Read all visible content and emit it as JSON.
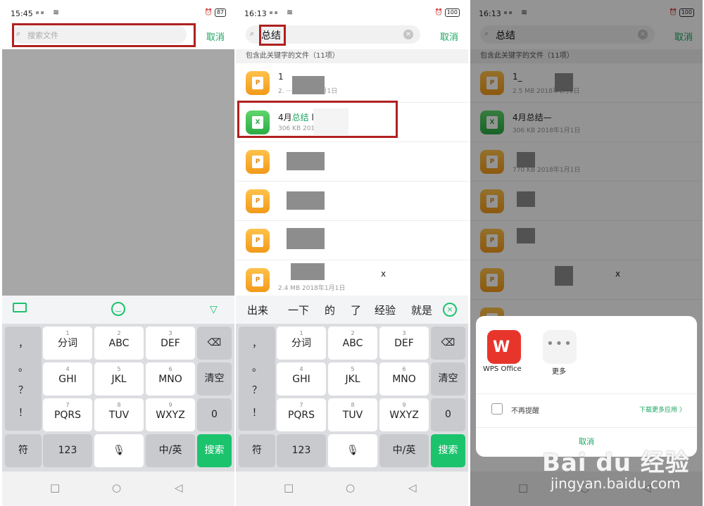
{
  "panel1": {
    "status": {
      "time": "15:45",
      "signal": "ᵢₗ ᵢₗ",
      "battery": "87"
    },
    "search": {
      "placeholder": "搜索文件",
      "cancel": "取消"
    },
    "kbtop": {
      "keyboard_icon": "keyboard-icon",
      "emoji_icon": "emoji-icon",
      "collapse_icon": "chevron-down-icon"
    }
  },
  "panel2": {
    "status": {
      "time": "16:13",
      "signal": "ᵢₗ ᵢₗ",
      "battery": "100"
    },
    "search": {
      "value": "总结",
      "cancel": "取消"
    },
    "list_header": "包含此关键字的文件（11项）",
    "files": [
      {
        "name_prefix": "1",
        "name_highlight": "",
        "name_suffix": "",
        "meta": "2.  ··· 2018年1月1日",
        "icon": "ppt"
      },
      {
        "name_prefix": "4月",
        "name_highlight": "总结",
        "name_suffix": "           lsx",
        "meta": "306 KB  2018",
        "icon": "xls"
      },
      {
        "name_prefix": "",
        "name_highlight": "",
        "name_suffix": "",
        "meta": "",
        "icon": "ppt"
      },
      {
        "name_prefix": "",
        "name_highlight": "",
        "name_suffix": "",
        "meta": "",
        "icon": "ppt"
      },
      {
        "name_prefix": "",
        "name_highlight": "",
        "name_suffix": "",
        "meta": "",
        "icon": "ppt"
      },
      {
        "name_prefix": "",
        "name_highlight": "",
        "name_suffix": "x",
        "meta": "2.4 MB  2018年1月1日",
        "icon": "ppt"
      }
    ],
    "suggestions": [
      "出来",
      "一下",
      "的",
      "了",
      "经验",
      "就是"
    ]
  },
  "panel3": {
    "status": {
      "time": "16:13",
      "signal": "ᵢₗ ᵢₗ",
      "battery": "100"
    },
    "search": {
      "value": "总结",
      "cancel": "取消"
    },
    "list_header": "包含此关键字的文件（11项）",
    "files": [
      {
        "name": "1_",
        "meta": "2.5 MB  2018年1月1日",
        "icon": "ppt"
      },
      {
        "name": "4月总结—",
        "meta": "306 KB  2018年1月1日",
        "icon": "xls"
      },
      {
        "name": "",
        "meta": "770 KB  2018年1月1日",
        "icon": "ppt"
      },
      {
        "name": "",
        "meta": "",
        "icon": "ppt"
      },
      {
        "name": "",
        "meta": "",
        "icon": "ppt"
      },
      {
        "name": "x",
        "meta": "",
        "icon": "ppt"
      }
    ],
    "sheet": {
      "apps": [
        {
          "name": "WPS Office",
          "icon": "wps-office-icon"
        },
        {
          "name": "更多",
          "icon": "more-dots-icon"
        }
      ],
      "dont_remind": "不再提醒",
      "download_more": "下载更多应用 〉",
      "cancel": "取消"
    }
  },
  "keyboard": {
    "symbols": [
      "，",
      "。",
      "？",
      "！"
    ],
    "rows": [
      [
        {
          "num": "1",
          "label": "分词"
        },
        {
          "num": "2",
          "label": "ABC"
        },
        {
          "num": "3",
          "label": "DEF"
        }
      ],
      [
        {
          "num": "4",
          "label": "GHI"
        },
        {
          "num": "5",
          "label": "JKL"
        },
        {
          "num": "6",
          "label": "MNO"
        }
      ],
      [
        {
          "num": "7",
          "label": "PQRS"
        },
        {
          "num": "8",
          "label": "TUV"
        },
        {
          "num": "9",
          "label": "WXYZ"
        }
      ]
    ],
    "backspace": "⌫",
    "clear": "清空",
    "zero": "0",
    "fu": "符",
    "num123": "123",
    "mic": "🎙",
    "lang": "中/英",
    "search": "搜索"
  },
  "nav": {
    "square": "□",
    "circle": "○",
    "back": "◁"
  },
  "watermark": {
    "brand": "Bai du 经验",
    "url": "jingyan.baidu.com"
  },
  "colors": {
    "accent": "#1cc36d",
    "highlight_box": "#b02020"
  }
}
